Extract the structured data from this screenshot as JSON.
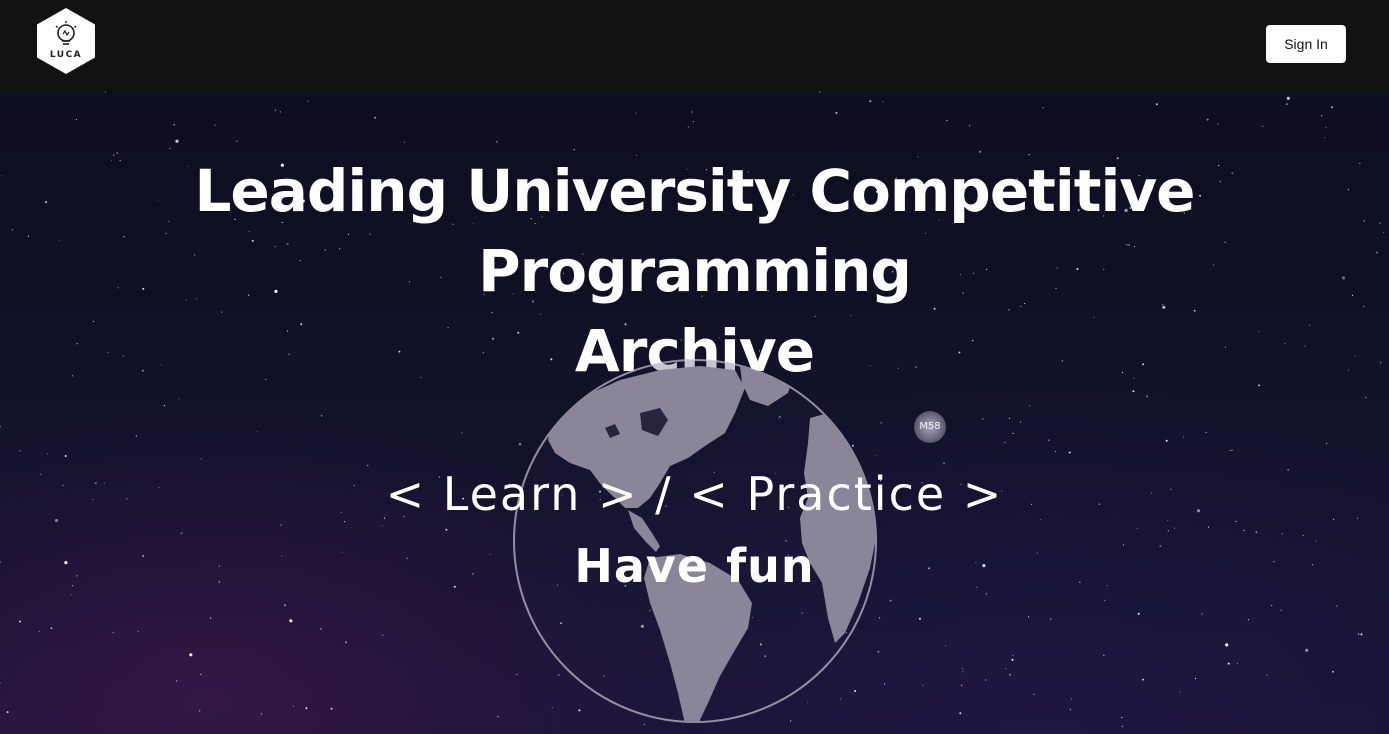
{
  "header": {
    "logo_text": "LUCA",
    "signin_label": "Sign In"
  },
  "hero": {
    "headline_line1": "Leading University Competitive Programming",
    "headline_line2": "Archive",
    "tagline": "< Learn > / < Practice >",
    "subtag": "Have fun",
    "badge": "M58"
  },
  "colors": {
    "topbar": "#121212",
    "text": "#ffffff",
    "globe_land": "#8a8598",
    "background": "#0d0e1e"
  },
  "icons": {
    "logo": "lightbulb-hexagon-icon",
    "globe": "globe-icon"
  }
}
